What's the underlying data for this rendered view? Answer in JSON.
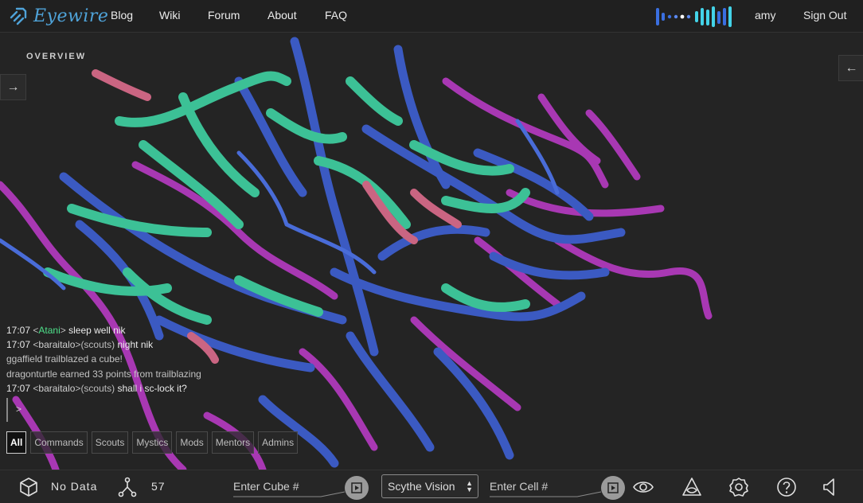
{
  "header": {
    "logo_text": "Eyewire",
    "nav": [
      "Blog",
      "Wiki",
      "Forum",
      "About",
      "FAQ"
    ],
    "user": "amy",
    "sign_out": "Sign Out",
    "activity_colors": {
      "blue": "#3a6fe0",
      "cyan": "#43d3e8",
      "white": "#ffffff"
    }
  },
  "scene": {
    "overview_label": "OVERVIEW",
    "expand_left_icon": "arrow-right-icon",
    "expand_right_icon": "arrow-left-icon",
    "neuron_colors": {
      "blue": "#3d5fd0",
      "teal": "#3fcfa0",
      "magenta": "#b43ac0",
      "pink": "#d96b8a"
    }
  },
  "chat": {
    "lines": [
      {
        "time": "17:07",
        "user": "Atani",
        "user_color": "#4ee08a",
        "team": "",
        "text": "sleep well nik"
      },
      {
        "time": "17:07",
        "user": "baraitalo",
        "user_color": "#cfcfcf",
        "team": "(scouts)",
        "text": "night nik"
      },
      {
        "system": "ggaffield trailblazed a cube!"
      },
      {
        "system": "dragonturtle earned 33 points from trailblazing"
      },
      {
        "time": "17:07",
        "user": "baraitalo",
        "user_color": "#cfcfcf",
        "team": "(scouts)",
        "text": "shall i sc-lock it?"
      }
    ],
    "prompt": ">",
    "tabs": [
      "All",
      "Commands",
      "Scouts",
      "Mystics",
      "Mods",
      "Mentors",
      "Admins"
    ],
    "active_tab": "All"
  },
  "bottom": {
    "cube_icon": "cube-icon",
    "no_data": "No Data",
    "branch_icon": "branch-icon",
    "branch_count": "57",
    "cube_input_placeholder": "Enter Cube #",
    "vision_selected": "Scythe Vision",
    "cell_input_placeholder": "Enter Cell #",
    "icons": [
      "eye-icon",
      "triangle-eye-icon",
      "gear-icon",
      "help-icon",
      "sound-icon"
    ]
  }
}
